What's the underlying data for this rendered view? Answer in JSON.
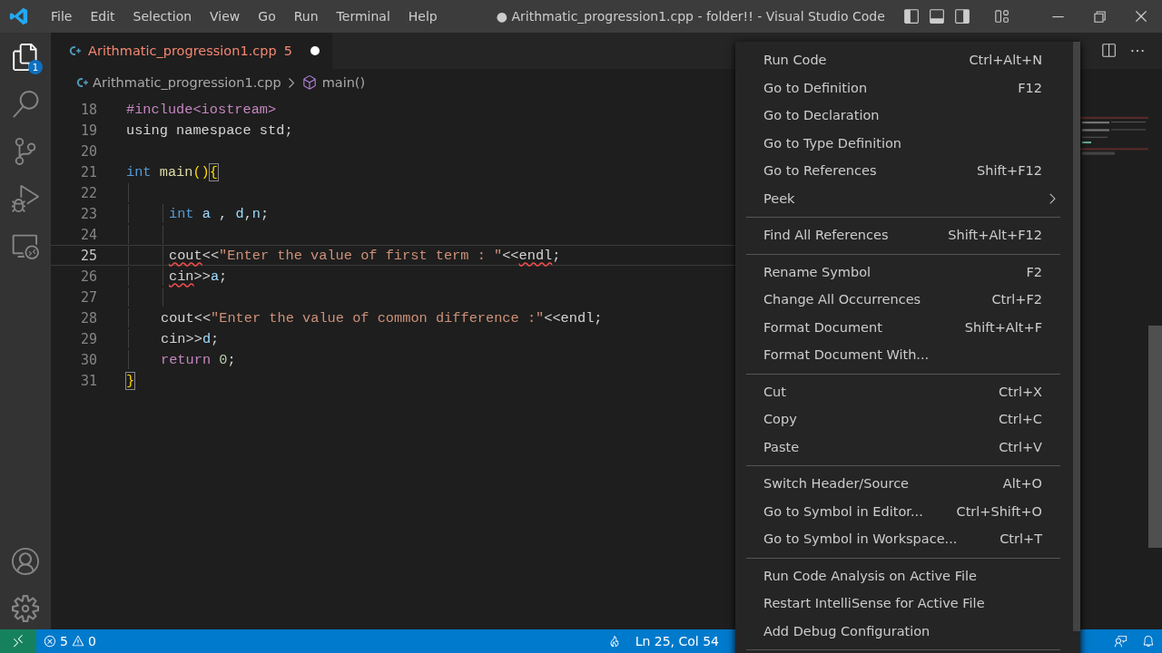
{
  "title_bar": {
    "menu": [
      "File",
      "Edit",
      "Selection",
      "View",
      "Go",
      "Run",
      "Terminal",
      "Help"
    ],
    "title": "● Arithmatic_progression1.cpp - folder!! - Visual Studio Code"
  },
  "activity_bar": {
    "top": [
      {
        "kind": "explorer",
        "badge": "1"
      },
      {
        "kind": "search"
      },
      {
        "kind": "source-control"
      },
      {
        "kind": "run-debug"
      },
      {
        "kind": "remote"
      }
    ],
    "bottom": [
      {
        "kind": "account"
      },
      {
        "kind": "settings"
      }
    ]
  },
  "tab": {
    "label": "Arithmatic_progression1.cpp",
    "problems": "5",
    "dirty": true
  },
  "breadcrumb": {
    "file": "Arithmatic_progression1.cpp",
    "symbol": "main()"
  },
  "code": [
    {
      "number": "18",
      "kind": "top",
      "current": false,
      "tokens": [
        {
          "kind": "directive",
          "text": "#include<iostream>"
        }
      ]
    },
    {
      "number": "19",
      "kind": "top",
      "current": false,
      "tokens": [
        {
          "kind": "plain",
          "text": "using namespace std;"
        }
      ]
    },
    {
      "number": "20",
      "kind": "top",
      "current": false
    },
    {
      "number": "21",
      "kind": "top",
      "current": false,
      "tokens": [
        {
          "kind": "keyword",
          "text": "int "
        },
        {
          "kind": "function",
          "text": "main"
        },
        {
          "kind": "bracket",
          "text": "()"
        },
        {
          "kind": "match",
          "text": "{"
        }
      ]
    },
    {
      "number": "22",
      "kind": "block",
      "current": false
    },
    {
      "number": "23",
      "kind": "nested",
      "current": false,
      "tokens": [
        {
          "kind": "keyword",
          "text": "int "
        },
        {
          "kind": "variable",
          "text": "a"
        },
        {
          "kind": "plain",
          "text": " , "
        },
        {
          "kind": "variable",
          "text": "d"
        },
        {
          "kind": "plain",
          "text": ","
        },
        {
          "kind": "variable",
          "text": "n"
        },
        {
          "kind": "plain",
          "text": ";"
        }
      ]
    },
    {
      "number": "24",
      "kind": "nested",
      "current": false
    },
    {
      "number": "25",
      "kind": "nested",
      "current": true,
      "tokens": [
        {
          "kind": "plain",
          "text": "cout",
          "error": true
        },
        {
          "kind": "plain",
          "text": "<<"
        },
        {
          "kind": "string",
          "text": "\"Enter the value of first term : \""
        },
        {
          "kind": "plain",
          "text": "<<"
        },
        {
          "kind": "plain",
          "text": "endl",
          "error": true
        },
        {
          "kind": "plain",
          "text": ";"
        }
      ]
    },
    {
      "number": "26",
      "kind": "nested",
      "current": false,
      "tokens": [
        {
          "kind": "plain",
          "text": "cin",
          "error": true
        },
        {
          "kind": "plain",
          "text": ">>"
        },
        {
          "kind": "variable",
          "text": "a"
        },
        {
          "kind": "plain",
          "text": ";"
        }
      ]
    },
    {
      "number": "27",
      "kind": "nested",
      "current": false
    },
    {
      "number": "28",
      "kind": "block",
      "current": false,
      "tokens": [
        {
          "kind": "plain",
          "text": "cout<<"
        },
        {
          "kind": "string",
          "text": "\"Enter the value of common difference :\""
        },
        {
          "kind": "plain",
          "text": "<<endl;"
        }
      ]
    },
    {
      "number": "29",
      "kind": "block",
      "current": false,
      "tokens": [
        {
          "kind": "plain",
          "text": "cin>>"
        },
        {
          "kind": "variable",
          "text": "d"
        },
        {
          "kind": "plain",
          "text": ";"
        }
      ]
    },
    {
      "number": "30",
      "kind": "block",
      "current": false,
      "tokens": [
        {
          "kind": "control",
          "text": "return "
        },
        {
          "kind": "number",
          "text": "0"
        },
        {
          "kind": "plain",
          "text": ";"
        }
      ]
    },
    {
      "number": "31",
      "kind": "top",
      "current": false,
      "tokens": [
        {
          "kind": "match",
          "text": "}"
        }
      ]
    }
  ],
  "context_menu": [
    {
      "kind": "item",
      "label": "Run Code",
      "shortcut": "Ctrl+Alt+N"
    },
    {
      "kind": "item",
      "label": "Go to Definition",
      "shortcut": "F12"
    },
    {
      "kind": "item",
      "label": "Go to Declaration"
    },
    {
      "kind": "item",
      "label": "Go to Type Definition"
    },
    {
      "kind": "item",
      "label": "Go to References",
      "shortcut": "Shift+F12"
    },
    {
      "kind": "submenu",
      "label": "Peek"
    },
    {
      "kind": "separator"
    },
    {
      "kind": "item",
      "label": "Find All References",
      "shortcut": "Shift+Alt+F12"
    },
    {
      "kind": "separator"
    },
    {
      "kind": "item",
      "label": "Rename Symbol",
      "shortcut": "F2"
    },
    {
      "kind": "item",
      "label": "Change All Occurrences",
      "shortcut": "Ctrl+F2"
    },
    {
      "kind": "item",
      "label": "Format Document",
      "shortcut": "Shift+Alt+F"
    },
    {
      "kind": "item",
      "label": "Format Document With..."
    },
    {
      "kind": "separator"
    },
    {
      "kind": "item",
      "label": "Cut",
      "shortcut": "Ctrl+X"
    },
    {
      "kind": "item",
      "label": "Copy",
      "shortcut": "Ctrl+C"
    },
    {
      "kind": "item",
      "label": "Paste",
      "shortcut": "Ctrl+V"
    },
    {
      "kind": "separator"
    },
    {
      "kind": "item",
      "label": "Switch Header/Source",
      "shortcut": "Alt+O"
    },
    {
      "kind": "item",
      "label": "Go to Symbol in Editor...",
      "shortcut": "Ctrl+Shift+O"
    },
    {
      "kind": "item",
      "label": "Go to Symbol in Workspace...",
      "shortcut": "Ctrl+T"
    },
    {
      "kind": "separator"
    },
    {
      "kind": "item",
      "label": "Run Code Analysis on Active File"
    },
    {
      "kind": "item",
      "label": "Restart IntelliSense for Active File"
    },
    {
      "kind": "item",
      "label": "Add Debug Configuration"
    },
    {
      "kind": "separator"
    }
  ],
  "status_bar": {
    "errors": "5",
    "warnings": "0",
    "position": "Ln 25, Col 54"
  }
}
